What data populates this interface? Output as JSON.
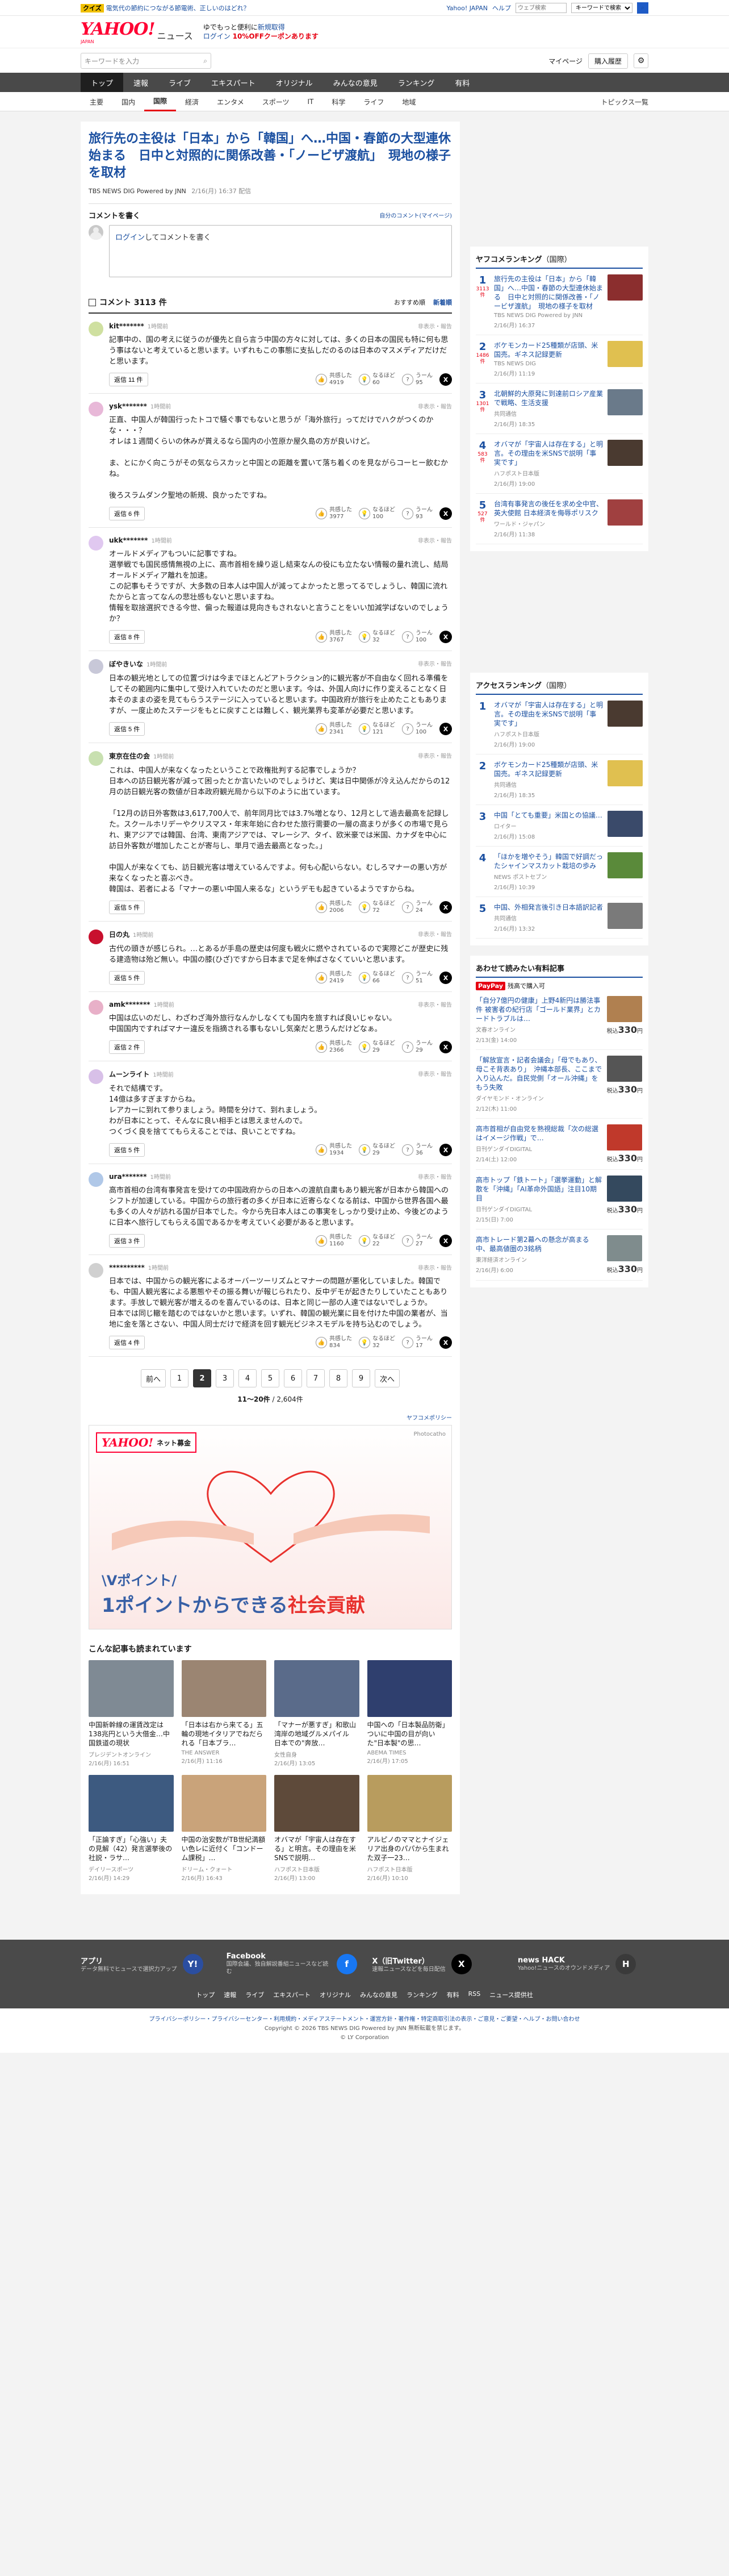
{
  "topstrip": {
    "quiz_tag": "クイズ",
    "quiz_text": "電気代の節約につながる節電術、正しいのはどれ？",
    "links": [
      "Yahoo! JAPAN",
      "ヘルプ"
    ],
    "search_placeholder": "ウェブ検索",
    "search_scope": "キーワードで検索"
  },
  "brand": {
    "logo": "YAHOO!",
    "logo_sub": "JAPAN",
    "news": "ニュース",
    "promo_line1": "ゆでもっと便利に",
    "promo_line1b": "新規取得",
    "promo_line2_login": "ログイン",
    "promo_line2_rest": "10%OFFクーポンあります"
  },
  "search": {
    "placeholder": "キーワードを入力",
    "mypage": "マイページ",
    "purchase": "購入履歴"
  },
  "catnav": [
    "トップ",
    "速報",
    "ライブ",
    "エキスパート",
    "オリジナル",
    "みんなの意見",
    "ランキング",
    "有料"
  ],
  "subnav": {
    "items": [
      "主要",
      "国内",
      "国際",
      "経済",
      "エンタメ",
      "スポーツ",
      "IT",
      "科学",
      "ライフ",
      "地域"
    ],
    "active": 2,
    "topics": "トピックス一覧"
  },
  "article": {
    "title": "旅行先の主役は「日本」から「韓国」へ…中国・春節の大型連休始まる　日中と対照的に関係改善・「ノービザ渡航」　現地の様子を取材",
    "source": "TBS NEWS DIG Powered by JNN",
    "date": "2/16(月) 16:37 配信"
  },
  "comment_write": {
    "title": "コメントを書く",
    "guide": "自分のコメント(マイページ)",
    "login_link": "ログイン",
    "placeholder_rest": "してコメントを書く"
  },
  "comment_list": {
    "title": "コメント 3113 件",
    "sort_recommended": "おすすめ順",
    "sort_new": "新着順"
  },
  "labels": {
    "report": "非表示・報告",
    "reply": "返信",
    "agree": "共感した",
    "think": "なるほど",
    "hmm": "うーん"
  },
  "comments": [
    {
      "name": "kit*******",
      "time": "1時間前",
      "text": "記事中の、国の考えに従うのが優先と自ら言う中国の方々に対しては、多くの日本の国民も特に何も思う事はないと考えていると思います。いずれもこの事態に支払しだのるのは日本のマスメディアだけだと思います。",
      "replies": "返信 11 件",
      "agree": "4919",
      "think": "60",
      "hmm": "95",
      "color": "#cfe0a0"
    },
    {
      "name": "ysk*******",
      "time": "1時間前",
      "text": "正直、中国人が韓国行ったトコで騒ぐ事でもないと思うが「海外旅行」ってだけでハクがつくのかな・・・？\nオレは１週間くらいの休みが貰えるなら国内の小笠原か屋久島の方が良いけど。\n\nま、とにかく向こうがその気ならスカッと中国との距離を置いて落ち着くのを見ながらコーヒー飲むかね。\n\n後ろスラムダンク聖地の新規、良かったですね。",
      "replies": "返信 6 件",
      "agree": "3977",
      "think": "100",
      "hmm": "93",
      "color": "#e8b8d8"
    },
    {
      "name": "ukk*******",
      "time": "1時間前",
      "text": "オールドメディアもついに記事ですね。\n選挙戦でも国民感情無視の上に、高市首相を繰り返し結束なんの役にも立たない情報の量れ流し、結局オールドメディア離れを加速。\nこの記事もそうですが、大多数の日本人は中国人が減ってよかったと思ってるでしょうし、韓国に流れたからと言ってなんの悲壮感もないと思いますね。\n情報を取捨選択できる今世、偏った報道は見向きもされないと言うことをいい加減学ばないのでしょうか？",
      "replies": "返信 8 件",
      "agree": "3767",
      "think": "32",
      "hmm": "100",
      "color": "#e0c8f0"
    },
    {
      "name": "ぼやきいな",
      "time": "1時間前",
      "text": "日本の観光地としての位置づけは今までほとんどアトラクション的に観光客が不自由なく回れる準備をしてその範囲内に集中して受け入れていたのだと思います。今は、外国人向けに作り変えることなく日本そのままの姿を見てもらうステージに入っていると思います。中国政府が旅行を止めたこともありますが、一度止めたステージをもとに戻すことは難しく、観光業界も変革が必要だと思います。",
      "replies": "返信 5 件",
      "agree": "2341",
      "think": "121",
      "hmm": "100",
      "color": "#c8c8d8"
    },
    {
      "name": "東京在住の会",
      "time": "1時間前",
      "text": "これは、中国人が来なくなったということで政権批判する記事でしょうか？\n日本への訪日観光客が減って困ったとか言いたいのでしょうけど、実は日中関係が冷え込んだからの12月の訪日観光客の数値が日本政府観光局から以下のように出ています。\n\n「12月の訪日外客数は3,617,700人で、前年同月比では3.7%増となり、12月として過去最高を記録した。スクールホリデーやクリスマス・年末年始に合わせた旅行需要の一層の高まりが多くの市場で見られ、東アジアでは韓国、台湾、東南アジアでは、マレーシア、タイ、欧米豪では米国、カナダを中心に訪日外客数が増加したことが寄与し、単月で過去最高となった。」\n\n中国人が来なくても、訪日観光客は増えているんですよ。何も心配いらない。むしろマナーの悪い方が来なくなったと喜ぶべき。\n韓国は、若者による「マナーの悪い中国人来るな」というデモも起きているようですからね。",
      "replies": "返信 5 件",
      "agree": "2006",
      "think": "72",
      "hmm": "24",
      "color": "#c8e0b0"
    },
    {
      "name": "日の丸",
      "time": "1時間前",
      "text": "古代の頭きが感じられ。…とあるが手島の歴史は何度も戦火に燃やされているので実際どこが歴史に残る建造物は殆ど無い。中国の膝(ひざ)ですから日本まで足を伸ばさなくていいと思います。",
      "replies": "返信 5 件",
      "agree": "2419",
      "think": "66",
      "hmm": "51",
      "color": "#c8102e"
    },
    {
      "name": "amk*******",
      "time": "1時間前",
      "text": "中国は広いのだし、わざわざ海外旅行なんかしなくても国内を旅すれば良いじゃない。\n中国国内ですればマナー違反を指摘される事もないし気楽だと思うんだけどなぁ。",
      "replies": "返信 2 件",
      "agree": "2366",
      "think": "29",
      "hmm": "29",
      "color": "#e8b0c8"
    },
    {
      "name": "ムーンライト",
      "time": "1時間前",
      "text": "それで結構です。\n14億は多すぎますからね。\nレアカーに到れて参りましょう。時間を分けて、到れましょう。\nわが日本にとって、そんなに良い相手とは思えませんので。\nつくづく良を捨ててもらえることでは、良いことですね。",
      "replies": "返信 5 件",
      "agree": "1934",
      "think": "29",
      "hmm": "36",
      "color": "#d8c0e8"
    },
    {
      "name": "ura*******",
      "time": "1時間前",
      "text": "高市首相の台湾有事発言を受けての中国政府からの日本への渡航自粛もあり観光客が日本から韓国へのシフトが加速している。中国からの旅行者の多くが日本に近寄らなくなる前は、中国から世界各国へ最も多くの人々が訪れる国が日本でした。今から先日本人はこの事実をしっかり受け止め、今後どのように日本へ旅行してもらえる国であるかを考えていく必要があると思います。",
      "replies": "返信 3 件",
      "agree": "1160",
      "think": "22",
      "hmm": "27",
      "color": "#b0c8e8"
    },
    {
      "name": "**********",
      "time": "1時間前",
      "text": "日本では、中国からの観光客によるオーバーツーリズムとマナーの問題が悪化していました。韓国でも、中国人観光客による悪態やその振る舞いが報じられたり、反中デモが起きたりしていたこともあります。手放しで観光客が増えるのを喜んでいるのは、日本と同じ一部の人達ではないでしょうか。\n日本では同じ轍を踏むのではないかと思います。いずれ、韓国の観光業に目を付けた中国の業者が、当地に金を落とさない、中国人同士だけで経済を回す観光ビジネスモデルを持ち込むのでしょう。",
      "replies": "返信 4 件",
      "agree": "834",
      "think": "32",
      "hmm": "17",
      "color": "#d0d0d0"
    }
  ],
  "pager": {
    "prev": "前へ",
    "next": "次へ",
    "pages": [
      "1",
      "2",
      "3",
      "4",
      "5",
      "6",
      "7",
      "8",
      "9"
    ],
    "current": 1,
    "range": "11〜20件",
    "total": " / 2,604件"
  },
  "ad": {
    "policy": "ヤフコメポリシー",
    "logo": "YAHOO!",
    "logo_tag": "ネット募金",
    "photo_credit": "Photocatho",
    "line1": "\\Vポイント/",
    "line2a": "1ポイントからできる",
    "line2b": "社会貢献"
  },
  "related": {
    "title": "こんな記事も読まれています",
    "items": [
      {
        "title": "中国新幹線の運賃改定は138兆円という大借金…中国鉄道の現状",
        "source": "プレジデントオンライン",
        "date": "2/16(月) 16:51",
        "color": "#7f8a94"
      },
      {
        "title": "「日本は右から来てる」五輪の現地イタリアでねだられる「日本ブラ…",
        "source": "THE ANSWER",
        "date": "2/16(月) 11:16",
        "color": "#9b8572"
      },
      {
        "title": "「マナーが悪すぎ」和歌山湾岸の地域グルメパイル　日本での\"奔放…",
        "source": "女性自身",
        "date": "2/16(月) 13:05",
        "color": "#5a6b8a"
      },
      {
        "title": "中国への「日本製品防衛」ついに中国の目が向いた\"日本製\"の思…",
        "source": "ABEMA TIMES",
        "date": "2/16(月) 17:05",
        "color": "#2f3f6e"
      },
      {
        "title": "「正論すぎ」「心強い」夫の見解（42）発言選挙後の社説・ラサ…",
        "source": "デイリースポーツ",
        "date": "2/16(月) 14:29",
        "color": "#3d5a80"
      },
      {
        "title": "中国の治安数がTB世紀満額い色レに近付く「コンドーム課税」…",
        "source": "ドリーム・クォート",
        "date": "2/16(月) 16:43",
        "color": "#c9a37a"
      },
      {
        "title": "オバマが「宇宙人は存在する」と明言。その理由を米SNSで説明…",
        "source": "ハフポスト日本版",
        "date": "2/16(月) 13:00",
        "color": "#5e4a3a"
      },
      {
        "title": "アルピノのママとナイジェリア出身のパパから生まれた双子一23…",
        "source": "ハフポスト日本版",
        "date": "2/16(月) 10:10",
        "color": "#b89c5e"
      }
    ]
  },
  "rank_news": {
    "title": "ヤフコメランキング",
    "scope": "（国際）",
    "items": [
      {
        "no": "1",
        "count": "3113件",
        "title": "旅行先の主役は「日本」から「韓国」へ…中国・春節の大型連休始まる　日中と対照的に関係改善・「ノービザ渡航」　現地の様子を取材",
        "source": "TBS NEWS DIG Powered by JNN",
        "date": "2/16(月) 16:37",
        "color": "#8b2e2e"
      },
      {
        "no": "2",
        "count": "1486件",
        "title": "ボケモンカード25種類が店頭、米国売。ギネス記録更新",
        "source": "TBS NEWS DIG",
        "date": "2/16(月) 11:19",
        "color": "#e0c050"
      },
      {
        "no": "3",
        "count": "1301件",
        "title": "北朝鮮的大原発に到達前ロシア産業で戦略、生活支援",
        "source": "共同通信",
        "date": "2/16(月) 18:35",
        "color": "#6a7a8a"
      },
      {
        "no": "4",
        "count": "583件",
        "title": "オバマが「宇宙人は存在する」と明言。その理由を米SNSで説明「事実です」",
        "source": "ハフポスト日本版",
        "date": "2/16(月) 19:00",
        "color": "#4a3a30"
      },
      {
        "no": "5",
        "count": "527件",
        "title": "台湾有事発言の後任を求め全中官、英大使館 日本経済を侮辱ポリスク",
        "source": "ワールド・ジャパン",
        "date": "2/16(月) 11:38",
        "color": "#a04040"
      }
    ]
  },
  "rank_access": {
    "title": "アクセスランキング",
    "scope": "（国際）",
    "items": [
      {
        "no": "1",
        "title": "オバマが「宇宙人は存在する」と明言。その理由を米SNSで説明「事実です」",
        "source": "ハフポスト日本版",
        "date": "2/16(月) 19:00",
        "color": "#4a3a30"
      },
      {
        "no": "2",
        "title": "ボケモンカード25種類が店頭、米国売。ギネス記録更新",
        "source": "共同通信",
        "date": "2/16(月) 18:35",
        "color": "#e0c050"
      },
      {
        "no": "3",
        "title": "中国「とても重要」米国との協議…",
        "source": "ロイター",
        "date": "2/16(月) 15:08",
        "color": "#3a4a6a"
      },
      {
        "no": "4",
        "title": "「ほかを増やそう」韓国で好調だったシャインマスカット栽培の歩み",
        "source": "NEWS ポストセブン",
        "date": "2/16(月) 10:39",
        "color": "#5a8a3a"
      },
      {
        "no": "5",
        "title": "中国、外相発言後引き日本語訳記者",
        "source": "共同通信",
        "date": "2/16(月) 13:32",
        "color": "#7a7a7a"
      }
    ]
  },
  "sponsor": {
    "title": "あわせて読みたい有料記事",
    "paypay_tag": "PayPay",
    "paypay_text": "残高で購入可",
    "items": [
      {
        "title": "「自分7億円の健康」上野4新円は勝法事件 被害者の紀行店「ゴールド業界」とカードトラブルは…",
        "source": "文春オンライン",
        "date": "2/13(金) 14:00",
        "price": "330",
        "color": "#b08050"
      },
      {
        "title": "「解放宣言・記者会議会」「母でもあり、母こそ背表あり」　沖縄本部長、ここまで入り込んだ。自民党側「オール沖縄」をもう失敗",
        "source": "ダイヤモンド・オンライン",
        "date": "2/12(木) 11:00",
        "price": "330",
        "color": "#555555"
      },
      {
        "title": "高市首相が自由党を熟視総裁「次の総選はイメージ作戦」で…",
        "source": "日刊ゲンダイDIGITAL",
        "date": "2/14(土) 12:00",
        "price": "330",
        "color": "#c0392b"
      },
      {
        "title": "高市トップ「鉄トート」「選挙運動」と解散を「沖縄」「AI革命外国語」注目10期目",
        "source": "日刊ゲンダイDIGITAL",
        "date": "2/15(日) 7:00",
        "price": "330",
        "color": "#34495e"
      },
      {
        "title": "高市トレード第2幕への懸念が高まる中、最高値圏の3銘柄",
        "source": "東洋経済オンライン",
        "date": "2/16(月) 6:00",
        "price": "330",
        "color": "#7f8c8d"
      }
    ]
  },
  "footer": {
    "apps": [
      {
        "name": "アプリ",
        "desc": "データ無料でヒュースで選択力アップ",
        "icon": "Y!",
        "color": "#2b4ea0"
      },
      {
        "name": "Facebook",
        "desc": "国際会議、独自解説番組ニュースなど読む",
        "icon": "f",
        "color": "#1877f2"
      },
      {
        "name": "X（旧Twitter）",
        "desc": "速報ニュースなどを毎日配信",
        "icon": "X",
        "color": "#000000"
      },
      {
        "name": "news HACK",
        "desc": "Yahoo!ニュースのオウンドメディア",
        "icon": "H",
        "color": "#3a3a3a"
      }
    ],
    "links": [
      "トップ",
      "速報",
      "ライブ",
      "エキスパート",
      "オリジナル",
      "みんなの意見",
      "ランキング",
      "有料",
      "RSS",
      "ニュース提供社"
    ],
    "legal1": "プライバシーポリシー・プライバシーセンター・利用規約・メディアステートメント・運営方針・著作権・特定商取引法の表示・ご意見・ご要望・ヘルプ・お問い合わせ",
    "legal2": "Copyright © 2026 TBS NEWS DIG Powered by JNN 無断転載を禁じます。",
    "legal3": "© LY Corporation"
  }
}
